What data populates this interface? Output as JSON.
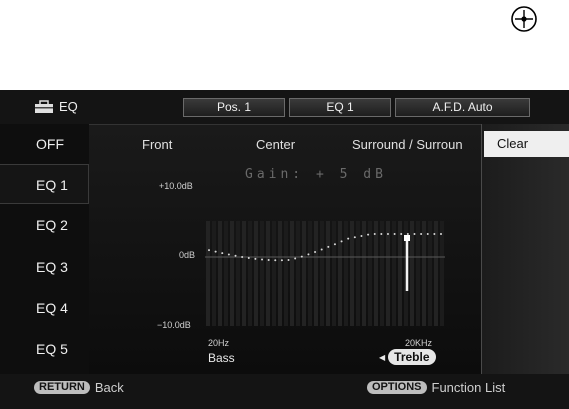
{
  "header": {
    "title": "EQ",
    "position": "Pos. 1",
    "eq_preset": "EQ 1",
    "afd_mode": "A.F.D. Auto"
  },
  "sidebar": {
    "items": [
      {
        "label": "OFF"
      },
      {
        "label": "EQ 1",
        "selected": true
      },
      {
        "label": "EQ 2"
      },
      {
        "label": "EQ 3"
      },
      {
        "label": "EQ 4"
      },
      {
        "label": "EQ 5"
      }
    ]
  },
  "speakers": [
    "Front",
    "Center",
    "Surround / Surroun"
  ],
  "gain_readout": "Gain: + 5 dB",
  "graph": {
    "y_max_label": "+10.0dB",
    "y_mid_label": "0dB",
    "y_min_label": "−10.0dB",
    "x_min_label": "20Hz",
    "x_max_label": "20KHz",
    "gain_db": 5
  },
  "controls": {
    "bass": "Bass",
    "treble": "Treble"
  },
  "right_panel": {
    "clear_label": "Clear"
  },
  "footer": {
    "return_key": "RETURN",
    "return_label": "Back",
    "options_key": "OPTIONS",
    "options_label": "Function List"
  },
  "colors": {
    "screen_bg": "#0e0e0e",
    "selected_bg": "#efefef",
    "text": "#e8e8e8"
  }
}
